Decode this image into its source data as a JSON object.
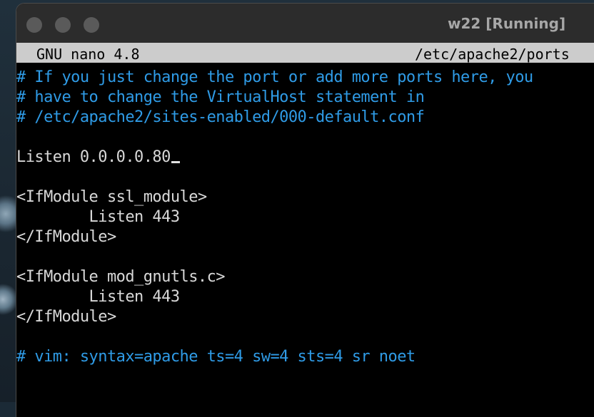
{
  "window": {
    "title": "w22 [Running]"
  },
  "nano": {
    "app_name": "GNU nano 4.8",
    "file_path": "/etc/apache2/ports"
  },
  "lines": [
    "# If you just change the port or add more ports here, you",
    "# have to change the VirtualHost statement in",
    "# /etc/apache2/sites-enabled/000-default.conf",
    "",
    "Listen 0.0.0.0.80",
    "",
    "<IfModule ssl_module>",
    "        Listen 443",
    "</IfModule>",
    "",
    "<IfModule mod_gnutls.c>",
    "        Listen 443",
    "</IfModule>",
    "",
    "# vim: syntax=apache ts=4 sw=4 sts=4 sr noet"
  ],
  "colors": {
    "comment": "#2f9be6",
    "text": "#d8d8d8",
    "header_bg": "#cccccc",
    "background": "#000000"
  },
  "icons": {
    "close": "close-traffic-light-icon",
    "minimize": "minimize-traffic-light-icon",
    "zoom": "zoom-traffic-light-icon"
  }
}
